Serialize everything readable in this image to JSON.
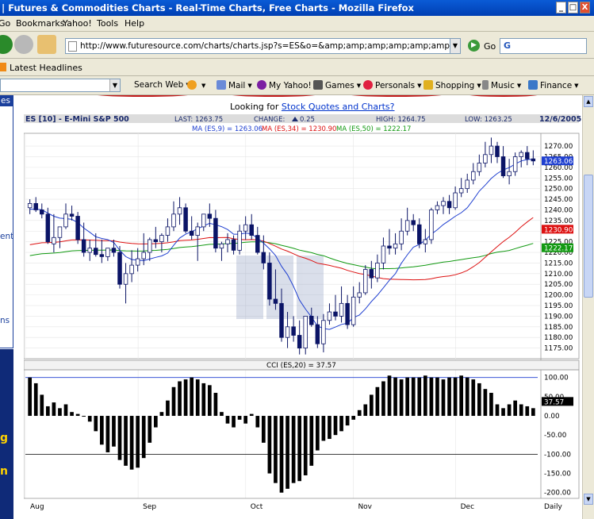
{
  "window": {
    "title": "| Futures & Commodities Charts - Real-Time Charts, Free Charts - Mozilla Firefox",
    "buttons": [
      "_",
      "□",
      "X"
    ]
  },
  "menu": [
    "Go",
    "Bookmarks",
    "Yahoo!",
    "Tools",
    "Help"
  ],
  "nav": {
    "url": "http://www.futuresource.com/charts/charts.jsp?s=ES&o=&amp;amp;amp;amp;amp;amp;amp;amp;amp;a=D8",
    "go_label": "Go",
    "search_logo": "G"
  },
  "bookmarks": {
    "latest_headlines": "Latest Headlines"
  },
  "yahoo_toolbar": [
    "Search Web",
    "Mail",
    "My Yahoo!",
    "Games",
    "Personals",
    "Shopping",
    "Music",
    "Finance"
  ],
  "left_strip": {
    "top": "es",
    "texts": [
      "ent",
      "ns"
    ],
    "ad_texts": [
      "g",
      "n"
    ]
  },
  "page": {
    "looking_prefix": "Looking for ",
    "looking_link": "Stock Quotes and Charts?"
  },
  "colors": {
    "ma9": "#1f3fd0",
    "ma34": "#dd1111",
    "ma50": "#119911",
    "candle": "#0b1466",
    "header_bg": "#dcdcdc",
    "header_text": "#1a2a6c"
  },
  "chart_data": {
    "type": "candlestick",
    "symbol": "ES [10] - E-Mini S&P 500",
    "date": "12/6/2005",
    "last_label": "LAST:",
    "last": "1263.75",
    "change_label": "CHANGE:",
    "change": "0.25",
    "high_label": "HIGH:",
    "high": "1264.75",
    "low_label": "LOW:",
    "low": "1263.25",
    "ma_legend": {
      "ma9": "MA (ES,9) = 1263.06",
      "ma34": "MA (ES,34) = 1230.90",
      "ma50": "MA (ES,50) = 1222.17"
    },
    "ma_badges": {
      "ma9": 1263.06,
      "ma34": 1230.9,
      "ma50": 1222.17
    },
    "ylim": [
      1170,
      1276
    ],
    "yticks": [
      1270,
      1265,
      1260,
      1255,
      1250,
      1245,
      1240,
      1235,
      1230,
      1225,
      1220,
      1215,
      1210,
      1205,
      1200,
      1195,
      1190,
      1185,
      1180,
      1175
    ],
    "ytick_labels": [
      "1270.00",
      "1265.00",
      "1260.00",
      "1255.00",
      "1250.00",
      "1245.00",
      "1240.00",
      "1235.00",
      "1230.00",
      "1225.00",
      "1220.00",
      "1215.00",
      "1210.00",
      "1205.00",
      "1200.00",
      "1195.00",
      "1190.00",
      "1185.00",
      "1180.00",
      "1175.00"
    ],
    "month_labels": [
      {
        "label": "Aug",
        "x": 0
      },
      {
        "label": "Sep",
        "x": 22
      },
      {
        "label": "Oct",
        "x": 43
      },
      {
        "label": "Nov",
        "x": 64
      },
      {
        "label": "Dec",
        "x": 84
      },
      {
        "label": "Daily",
        "x": 92
      }
    ],
    "candles": {
      "o": [
        1241,
        1243,
        1240,
        1238,
        1224,
        1227,
        1232,
        1238,
        1237,
        1226,
        1220,
        1222,
        1219,
        1218,
        1222,
        1220,
        1205,
        1210,
        1214,
        1217,
        1220,
        1226,
        1225,
        1228,
        1232,
        1238,
        1241,
        1230,
        1228,
        1232,
        1238,
        1236,
        1222,
        1224,
        1226,
        1221,
        1230,
        1233,
        1228,
        1220,
        1215,
        1198,
        1196,
        1180,
        1185,
        1181,
        1175,
        1190,
        1186,
        1177,
        1188,
        1192,
        1190,
        1196,
        1186,
        1199,
        1201,
        1212,
        1208,
        1215,
        1223,
        1222,
        1224,
        1230,
        1235,
        1233,
        1224,
        1226,
        1240,
        1242,
        1244,
        1241,
        1248,
        1250,
        1254,
        1258,
        1262,
        1266,
        1270,
        1265,
        1256,
        1258,
        1265,
        1267,
        1264
      ],
      "h": [
        1245,
        1246,
        1243,
        1241,
        1238,
        1232,
        1243,
        1242,
        1239,
        1234,
        1226,
        1229,
        1226,
        1222,
        1226,
        1223,
        1215,
        1221,
        1222,
        1229,
        1227,
        1232,
        1229,
        1236,
        1244,
        1246,
        1243,
        1237,
        1234,
        1238,
        1243,
        1240,
        1225,
        1229,
        1228,
        1233,
        1237,
        1238,
        1232,
        1228,
        1220,
        1212,
        1203,
        1192,
        1190,
        1188,
        1188,
        1194,
        1190,
        1191,
        1196,
        1200,
        1204,
        1200,
        1204,
        1206,
        1214,
        1216,
        1219,
        1227,
        1231,
        1229,
        1236,
        1241,
        1238,
        1236,
        1231,
        1241,
        1244,
        1246,
        1247,
        1251,
        1255,
        1257,
        1262,
        1266,
        1272,
        1274,
        1272,
        1270,
        1264,
        1267,
        1268,
        1270,
        1268
      ],
      "l": [
        1238,
        1239,
        1236,
        1224,
        1220,
        1222,
        1231,
        1235,
        1224,
        1218,
        1216,
        1218,
        1215,
        1216,
        1218,
        1203,
        1196,
        1206,
        1211,
        1214,
        1216,
        1222,
        1220,
        1225,
        1230,
        1233,
        1229,
        1226,
        1216,
        1230,
        1232,
        1220,
        1216,
        1220,
        1219,
        1219,
        1226,
        1226,
        1219,
        1212,
        1195,
        1193,
        1178,
        1175,
        1178,
        1172,
        1172,
        1185,
        1175,
        1173,
        1186,
        1188,
        1187,
        1184,
        1185,
        1196,
        1200,
        1203,
        1206,
        1212,
        1219,
        1219,
        1221,
        1228,
        1230,
        1222,
        1220,
        1224,
        1238,
        1238,
        1238,
        1240,
        1246,
        1248,
        1252,
        1256,
        1260,
        1262,
        1262,
        1255,
        1252,
        1256,
        1260,
        1261,
        1261
      ],
      "c": [
        1243,
        1240,
        1238,
        1225,
        1227,
        1232,
        1238,
        1237,
        1226,
        1220,
        1222,
        1219,
        1218,
        1222,
        1220,
        1205,
        1210,
        1214,
        1217,
        1220,
        1226,
        1225,
        1228,
        1232,
        1238,
        1241,
        1230,
        1228,
        1232,
        1238,
        1236,
        1222,
        1224,
        1226,
        1221,
        1230,
        1233,
        1228,
        1220,
        1215,
        1198,
        1196,
        1180,
        1185,
        1181,
        1175,
        1190,
        1186,
        1177,
        1188,
        1192,
        1190,
        1196,
        1186,
        1199,
        1201,
        1212,
        1208,
        1215,
        1223,
        1222,
        1224,
        1230,
        1235,
        1233,
        1224,
        1226,
        1240,
        1242,
        1244,
        1241,
        1248,
        1250,
        1254,
        1258,
        1262,
        1266,
        1270,
        1265,
        1256,
        1258,
        1265,
        1267,
        1264,
        1263
      ]
    },
    "cci": {
      "title": "CCI (ES,20) = 37.57",
      "badge": 37.57,
      "ylim": [
        -215,
        120
      ],
      "yticks": [
        100,
        50,
        0,
        -50,
        -100,
        -150,
        -200
      ],
      "ytick_labels": [
        "100.00",
        "50.00",
        "0.00",
        "-50.00",
        "-100.00",
        "-150.00",
        "-200.00"
      ],
      "guide_lines": [
        100,
        -100
      ],
      "values": [
        100,
        85,
        55,
        25,
        35,
        20,
        30,
        10,
        5,
        0,
        -15,
        -40,
        -75,
        -95,
        -80,
        -115,
        -130,
        -140,
        -135,
        -110,
        -70,
        -30,
        10,
        40,
        75,
        90,
        95,
        100,
        95,
        85,
        80,
        60,
        10,
        -20,
        -30,
        -10,
        -20,
        5,
        -30,
        -70,
        -150,
        -175,
        -200,
        -190,
        -175,
        -170,
        -155,
        -130,
        -90,
        -65,
        -60,
        -50,
        -40,
        -25,
        -10,
        15,
        30,
        55,
        75,
        90,
        105,
        100,
        95,
        100,
        100,
        100,
        105,
        100,
        100,
        95,
        100,
        100,
        105,
        100,
        95,
        85,
        70,
        60,
        30,
        20,
        30,
        40,
        30,
        25,
        20
      ]
    }
  }
}
